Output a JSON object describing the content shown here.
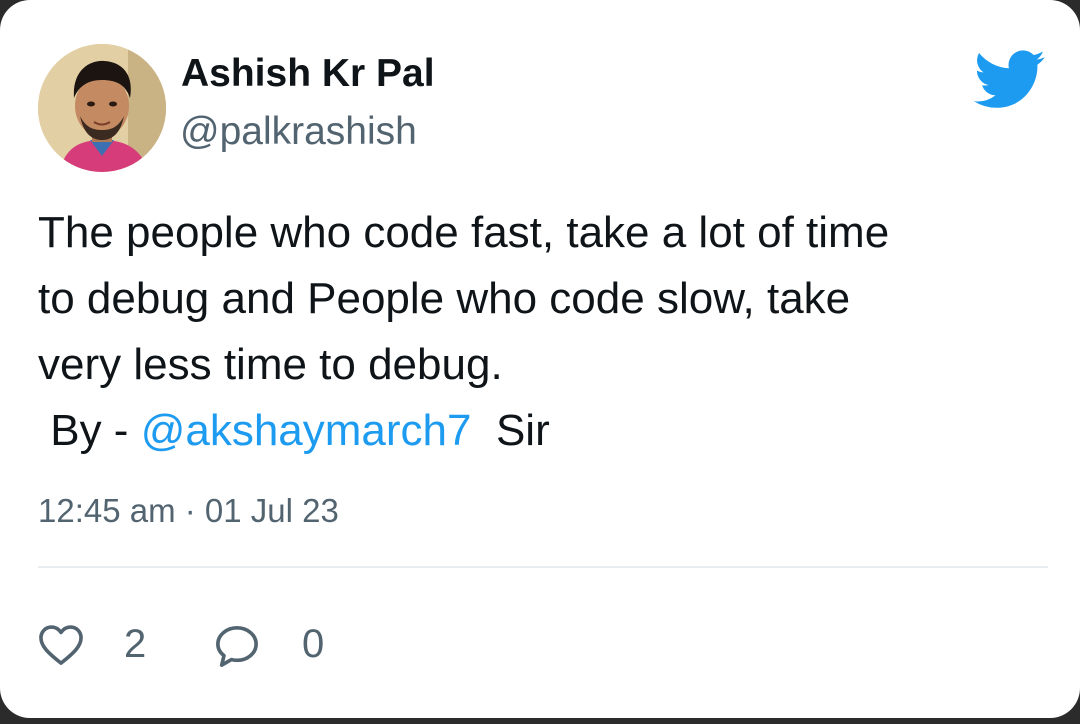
{
  "author": {
    "name": "Ashish Kr Pal",
    "handle": "@palkrashish"
  },
  "tweet": {
    "lines": [
      "The people who code fast, take a lot of time",
      "to debug and People who code slow, take",
      "very less time to debug."
    ],
    "by_prefix": "By -",
    "mention": "@akshaymarch7",
    "by_suffix": "Sir",
    "timestamp": "12:45 am · 01 Jul 23"
  },
  "actions": {
    "likes": "2",
    "replies": "0"
  },
  "icons": {
    "logo": "twitter-bird-icon",
    "like": "heart-icon",
    "reply": "speech-bubble-icon"
  },
  "colors": {
    "brand": "#1d9bf0",
    "text": "#0f1419",
    "secondary": "#536471"
  }
}
